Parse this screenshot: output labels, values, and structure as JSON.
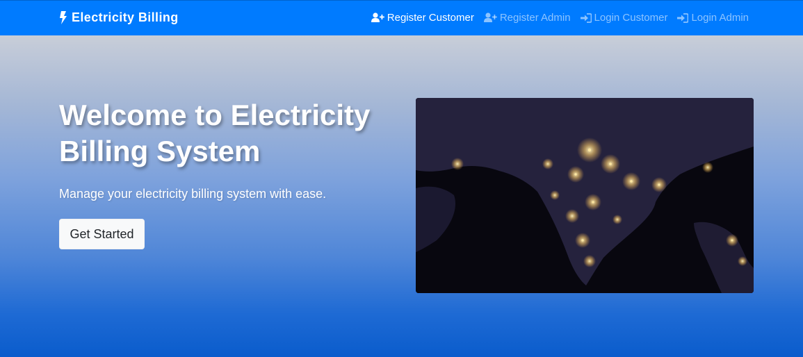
{
  "navbar": {
    "brand": "Electricity Billing",
    "links": [
      {
        "label": "Register Customer",
        "icon": "user-plus-icon"
      },
      {
        "label": "Register Admin",
        "icon": "user-plus-icon"
      },
      {
        "label": "Login Customer",
        "icon": "sign-in-icon"
      },
      {
        "label": "Login Admin",
        "icon": "sign-in-icon"
      }
    ]
  },
  "hero": {
    "title": "Welcome to Electricity Billing System",
    "subtitle": "Manage your electricity billing system with ease.",
    "cta_label": "Get Started",
    "image_icon": "india-night-lights-map"
  },
  "colors": {
    "navbar": "#007bff",
    "gradient_top": "#dcdcdc",
    "gradient_bottom": "#0a5ccc",
    "button_bg": "#f8f9fa"
  }
}
